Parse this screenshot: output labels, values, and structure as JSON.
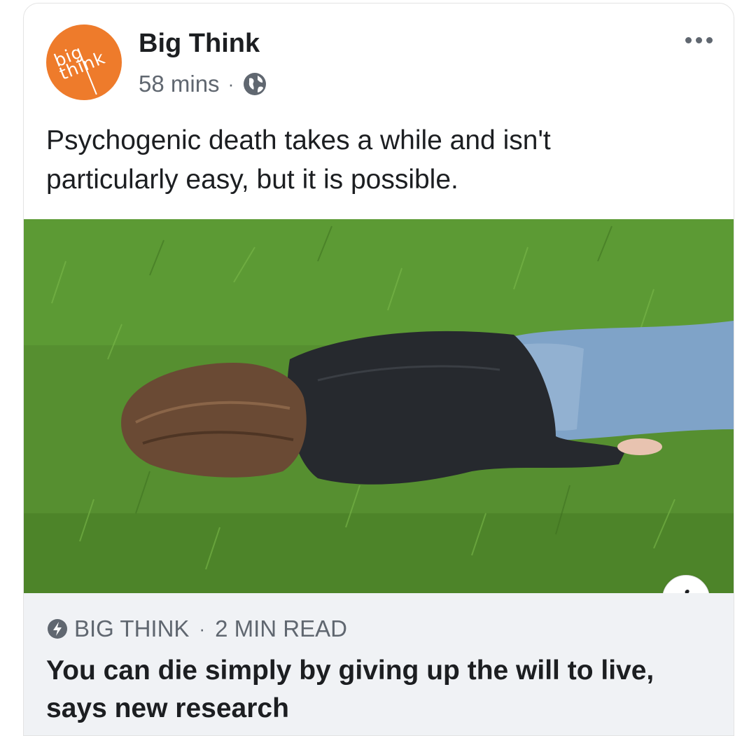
{
  "post": {
    "avatar_text_line1": "big",
    "avatar_text_line2": "think",
    "page_name": "Big Think",
    "time": "58 mins",
    "separator": "·",
    "text": "Psychogenic death takes a while and isn't particularly easy, but it is possible."
  },
  "link_preview": {
    "source": "BIG THINK",
    "read_time": "2 MIN READ",
    "separator": "·",
    "headline": "You can die simply by giving up the will to live, says new research"
  },
  "info_button": {
    "label": "i"
  },
  "icons": {
    "avatar": "big-think-logo-icon",
    "privacy": "globe-icon",
    "more": "more-options-icon",
    "source": "bolt-icon",
    "info": "info-icon"
  },
  "colors": {
    "brand_orange": "#ee7b2b",
    "text_primary": "#1c1e21",
    "text_secondary": "#606770",
    "preview_bg": "#f0f2f5"
  }
}
